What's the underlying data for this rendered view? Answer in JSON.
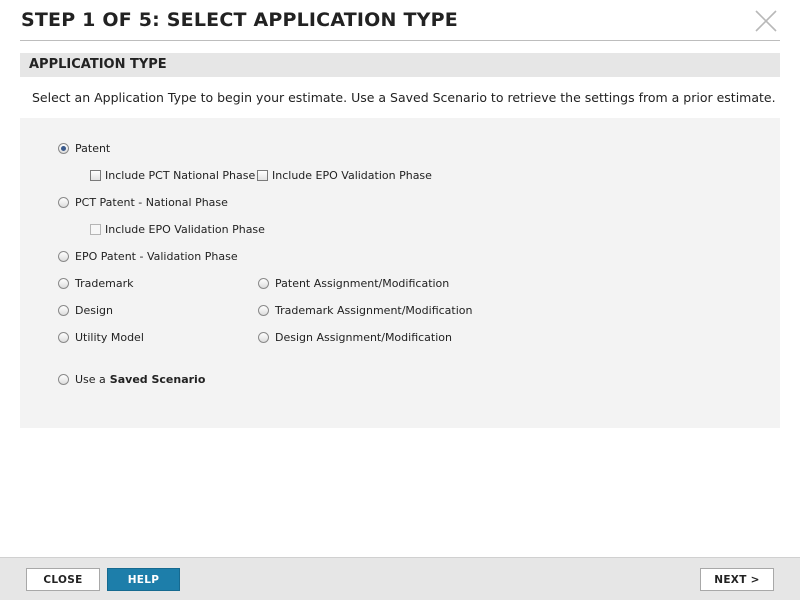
{
  "dialog": {
    "title": "STEP 1 OF 5: SELECT APPLICATION TYPE",
    "close_icon": "close-x-icon"
  },
  "section": {
    "header": "APPLICATION TYPE",
    "intro": "Select an Application Type to begin your estimate. Use a Saved Scenario to retrieve the settings from a prior estimate."
  },
  "options": {
    "patent": {
      "label": "Patent",
      "selected": true
    },
    "patent_include_pct": {
      "label": "Include PCT National Phase",
      "checked": false
    },
    "patent_include_epo": {
      "label": "Include EPO Validation Phase",
      "checked": false
    },
    "pct": {
      "label": "PCT Patent - National Phase",
      "selected": false
    },
    "pct_include_epo": {
      "label": "Include EPO Validation Phase",
      "checked": false,
      "disabled": true
    },
    "epo": {
      "label": "EPO Patent - Validation Phase",
      "selected": false
    },
    "trademark": {
      "label": "Trademark",
      "selected": false
    },
    "design": {
      "label": "Design",
      "selected": false
    },
    "utility_model": {
      "label": "Utility Model",
      "selected": false
    },
    "patent_assignment": {
      "label": "Patent Assignment/Modification",
      "selected": false
    },
    "trademark_assignment": {
      "label": "Trademark Assignment/Modification",
      "selected": false
    },
    "design_assignment": {
      "label": "Design Assignment/Modification",
      "selected": false
    },
    "saved_scenario": {
      "prefix": "Use a",
      "label": "Saved Scenario",
      "selected": false
    }
  },
  "footer": {
    "close_label": "CLOSE",
    "help_label": "HELP",
    "next_label": "NEXT >"
  },
  "colors": {
    "help_button": "#1d7eaa",
    "section_header_bg": "#e6e6e6",
    "panel_bg": "#f3f3f3"
  }
}
